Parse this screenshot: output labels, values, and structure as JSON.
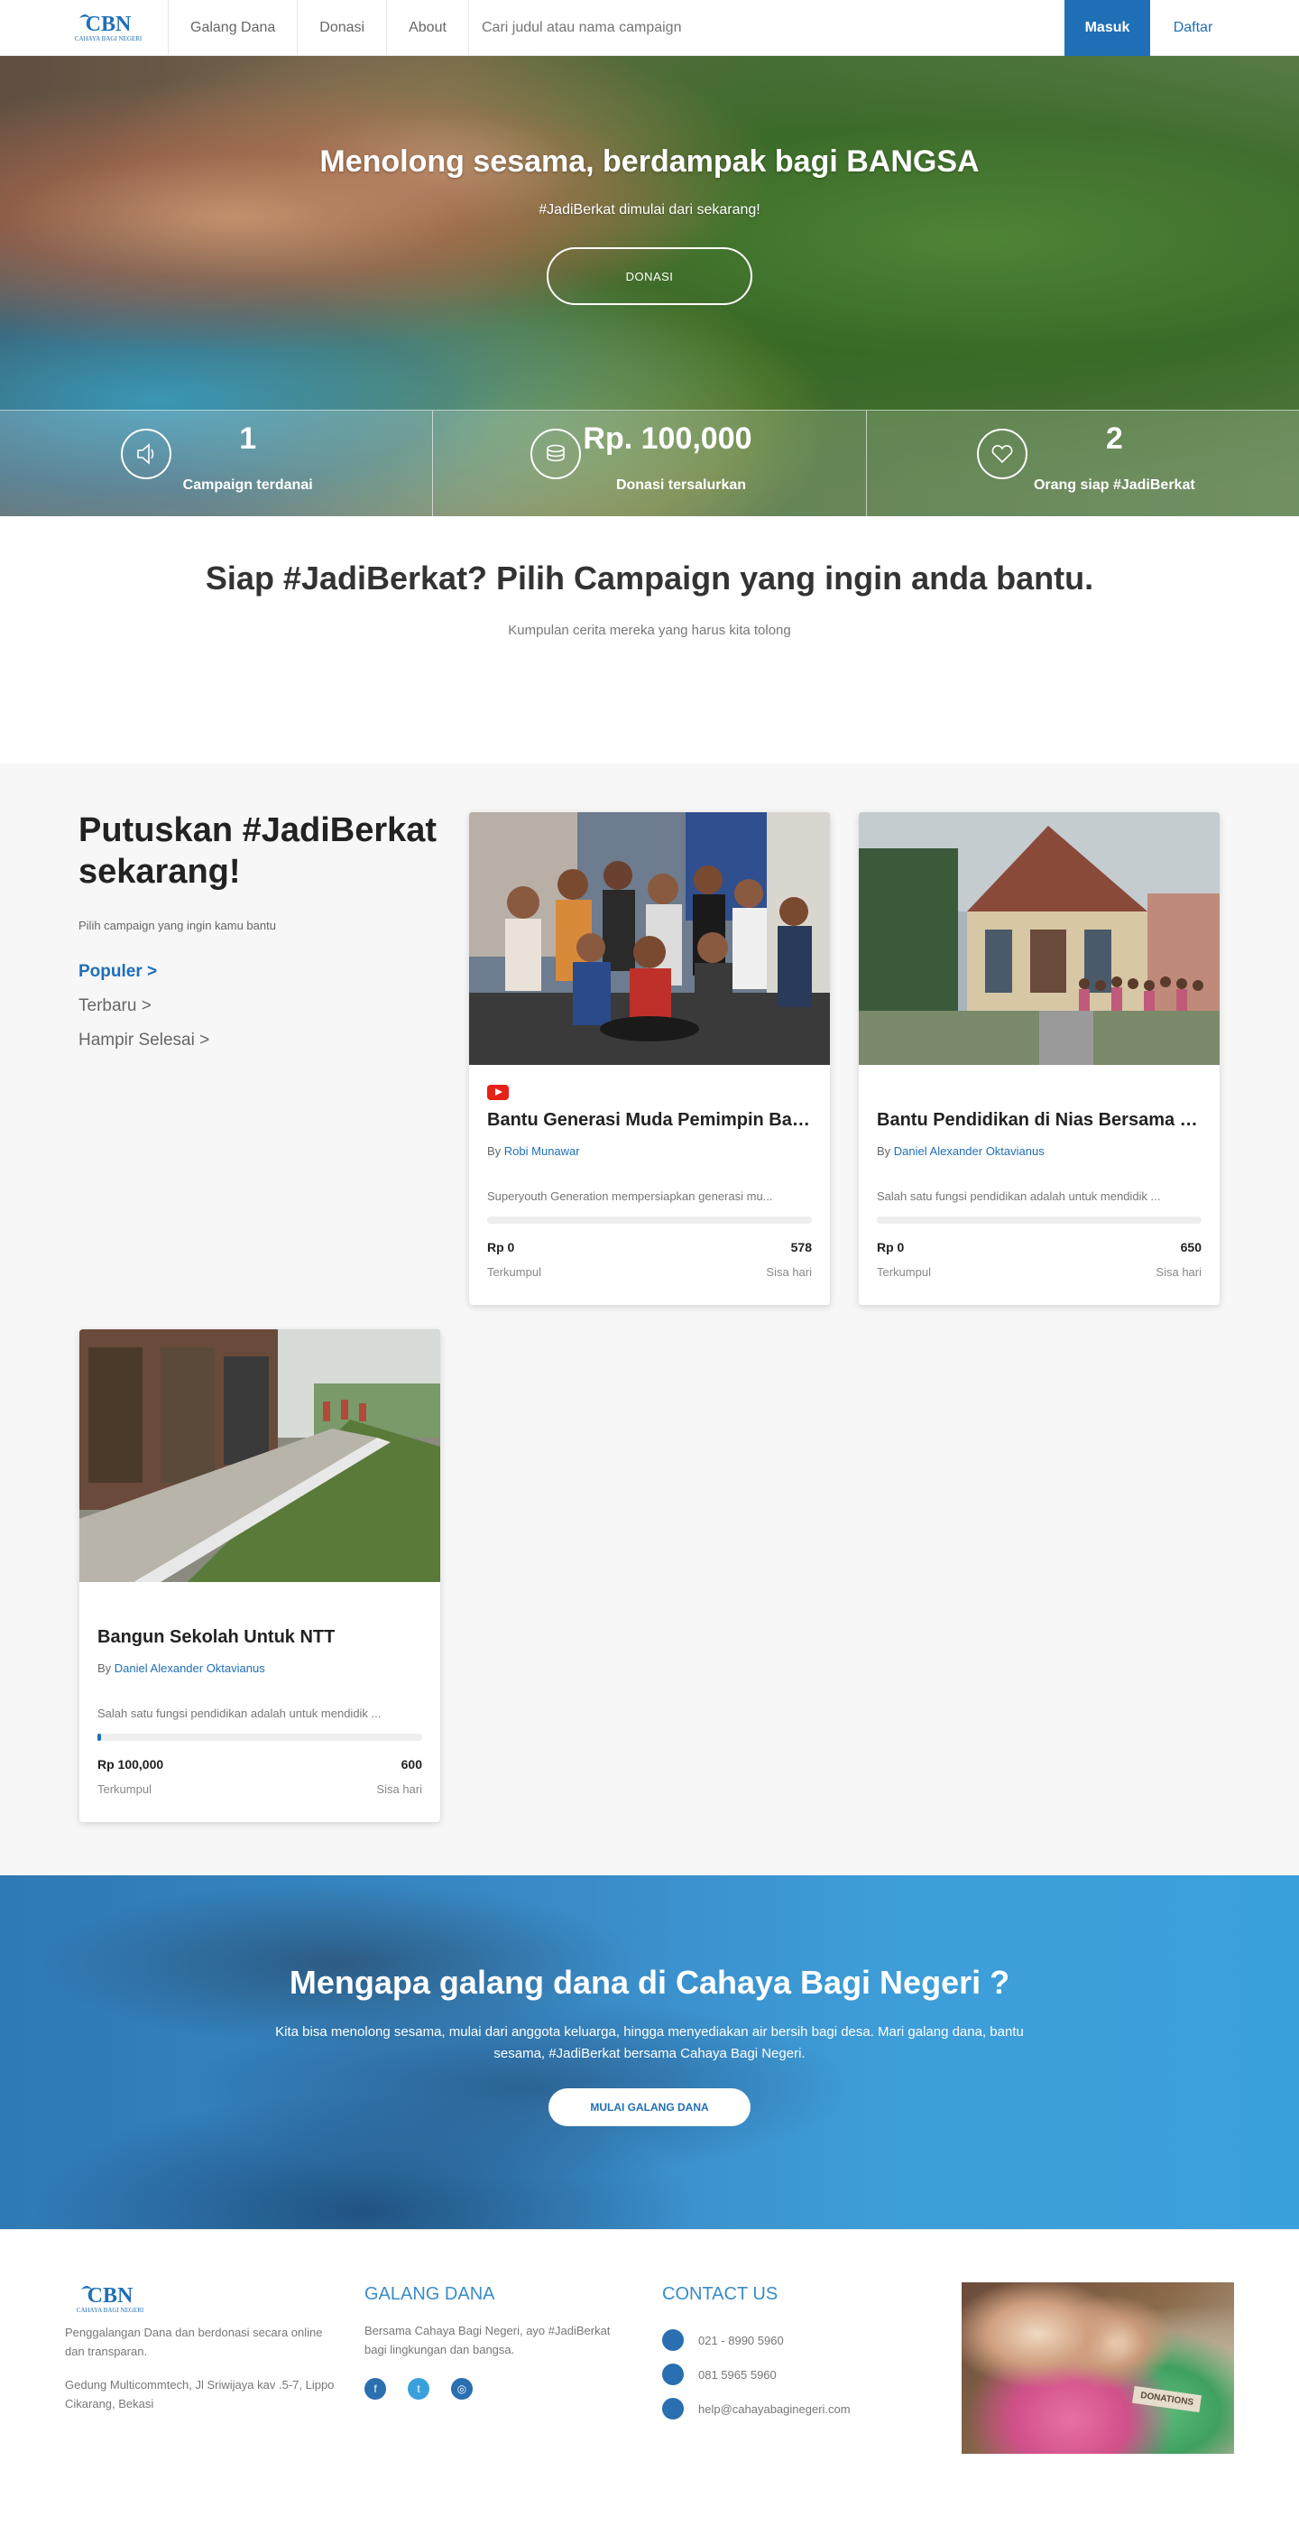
{
  "nav": {
    "logo_text": "CBN",
    "logo_subtext": "CAHAYA BAGI NEGERI",
    "links": [
      "Galang Dana",
      "Donasi",
      "About"
    ],
    "search_placeholder": "Cari judul atau nama campaign",
    "login_label": "Masuk",
    "register_label": "Daftar"
  },
  "hero": {
    "title": "Menolong sesama, berdampak bagi BANGSA",
    "subtitle": "#JadiBerkat dimulai dari sekarang!",
    "cta_label": "DONASI",
    "stats": [
      {
        "value": "1",
        "label": "Campaign terdanai",
        "icon": "speaker-icon"
      },
      {
        "value": "Rp. 100,000",
        "label": "Donasi tersalurkan",
        "icon": "coins-icon"
      },
      {
        "value": "2",
        "label": "Orang siap #JadiBerkat",
        "icon": "heart-icon"
      }
    ]
  },
  "intro": {
    "title": "Siap #JadiBerkat? Pilih Campaign yang ingin anda bantu.",
    "subtitle": "Kumpulan cerita mereka yang harus kita tolong"
  },
  "campaigns_section": {
    "title": "Putuskan #JadiBerkat sekarang!",
    "subtitle": "Pilih campaign yang ingin kamu bantu",
    "filters": [
      "Populer >",
      "Terbaru >",
      "Hampir Selesai >"
    ],
    "active_filter": 0,
    "by_prefix": "By",
    "collected_label": "Terkumpul",
    "days_left_label": "Sisa hari",
    "cards": [
      {
        "title": "Bantu Generasi Muda Pemimpin Bangs...",
        "author": "Robi Munawar",
        "description": "Superyouth Generation mempersiapkan generasi mu...",
        "amount": "Rp 0",
        "days_left": "578",
        "progress": 0,
        "has_video": true
      },
      {
        "title": "Bantu Pendidikan di Nias Bersama Ob...",
        "author": "Daniel Alexander Oktavianus",
        "description": "Salah satu fungsi pendidikan adalah untuk mendidik ...",
        "amount": "Rp 0",
        "days_left": "650",
        "progress": 0,
        "has_video": false
      },
      {
        "title": "Bangun Sekolah Untuk NTT",
        "author": "Daniel Alexander Oktavianus",
        "description": "Salah satu fungsi pendidikan adalah untuk mendidik ...",
        "amount": "Rp 100,000",
        "days_left": "600",
        "progress": 0.01,
        "has_video": false
      }
    ]
  },
  "why": {
    "title": "Mengapa galang dana di Cahaya Bagi Negeri ?",
    "text": "Kita bisa menolong sesama, mulai dari anggota keluarga, hingga menyediakan air bersih bagi desa. Mari galang dana, bantu sesama, #JadiBerkat bersama Cahaya Bagi Negeri.",
    "cta_label": "MULAI GALANG DANA"
  },
  "footer": {
    "description": "Penggalangan Dana dan berdonasi secara online dan transparan.",
    "address": "Gedung Multicommtech, Jl Sriwijaya kav .5-7, Lippo Cikarang, Bekasi",
    "galang_heading": "GALANG DANA",
    "galang_text": "Bersama Cahaya Bagi Negeri, ayo #JadiBerkat bagi lingkungan dan bangsa.",
    "contact_heading": "CONTACT US",
    "contacts": [
      "021 - 8990 5960",
      "081 5965 5960",
      "help@cahayabaginegeri.com"
    ],
    "image_label": "DONATIONS",
    "accent_color": "#3a8cc8"
  }
}
